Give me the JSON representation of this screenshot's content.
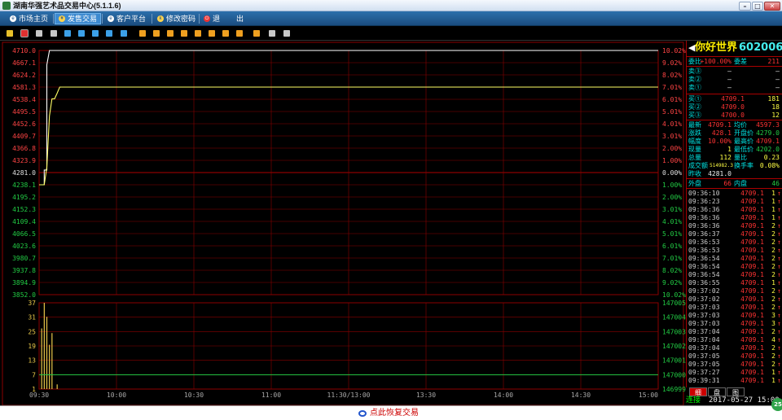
{
  "window": {
    "title": "湖南华强艺术品交易中心(5.1.1.6)"
  },
  "menu": {
    "items": [
      {
        "label": "市场主页",
        "icon": "globe-icon",
        "active": false
      },
      {
        "label": "发售交易",
        "icon": "hand-icon",
        "active": true
      },
      {
        "label": "客户平台",
        "icon": "globe-icon",
        "active": false
      },
      {
        "label": "修改密码",
        "icon": "key-icon",
        "active": false
      },
      {
        "label": "退",
        "icon": "power-icon",
        "active": false
      },
      {
        "label": "出",
        "icon": "",
        "active": false
      }
    ]
  },
  "toolbar": {
    "icons": [
      "bar-chart-icon",
      "line-chart-icon",
      "candlestick-icon",
      "table-icon",
      "list-icon",
      "q1-icon",
      "q2-icon",
      "q3-icon",
      "x-icon",
      "f1-icon",
      "f2-icon",
      "f3-icon",
      "f4-icon",
      "f5-icon",
      "f6-icon",
      "f7-icon",
      "f8-icon",
      "f9-icon",
      "draw-icon",
      "settings-icon"
    ]
  },
  "chart_data": [
    {
      "type": "line",
      "title": "",
      "y_ticks_left": [
        "4710.0",
        "4667.1",
        "4624.2",
        "4581.3",
        "4538.4",
        "4495.5",
        "4452.6",
        "4409.7",
        "4366.8",
        "4323.9",
        "4281.0",
        "4238.1",
        "4195.2",
        "4152.3",
        "4109.4",
        "4066.5",
        "4023.6",
        "3980.7",
        "3937.8",
        "3894.9",
        "3852.0"
      ],
      "y_ticks_right": [
        "10.02%",
        "9.02%",
        "8.02%",
        "7.01%",
        "6.01%",
        "5.01%",
        "4.01%",
        "3.01%",
        "2.00%",
        "1.00%",
        "0.00%",
        "1.00%",
        "2.00%",
        "3.01%",
        "4.01%",
        "5.01%",
        "6.01%",
        "7.01%",
        "8.02%",
        "9.02%",
        "10.02%"
      ],
      "x_ticks": [
        "09:30",
        "10:00",
        "10:30",
        "11:00",
        "11:30/13:00",
        "13:30",
        "14:00",
        "14:30",
        "15:00"
      ],
      "ylim": [
        3852.0,
        4710.0
      ],
      "prev_close": 4281.0,
      "series": [
        {
          "color": "#ffffff",
          "points": [
            [
              0,
              4238.1
            ],
            [
              2,
              4238.1
            ],
            [
              2,
              4290
            ],
            [
              3,
              4290
            ],
            [
              3,
              4660
            ],
            [
              4,
              4710.0
            ],
            [
              240,
              4710.0
            ]
          ]
        },
        {
          "color": "#ffff66",
          "points": [
            [
              0,
              4238.1
            ],
            [
              2,
              4238.1
            ],
            [
              3,
              4300
            ],
            [
              4,
              4480
            ],
            [
              5,
              4540
            ],
            [
              6,
              4540
            ],
            [
              7,
              4560
            ],
            [
              8,
              4581.3
            ],
            [
              9,
              4581.3
            ],
            [
              240,
              4581.3
            ]
          ]
        }
      ]
    },
    {
      "type": "bar",
      "y_ticks_left": [
        "37",
        "31",
        "25",
        "19",
        "13",
        "7",
        "1"
      ],
      "y_ticks_right": [
        "147005",
        "147004",
        "147003",
        "147002",
        "147001",
        "147000",
        "146999"
      ],
      "ylim": [
        0,
        37
      ],
      "bars": [
        [
          1,
          26
        ],
        [
          2,
          37
        ],
        [
          3,
          31
        ],
        [
          4,
          19
        ],
        [
          5,
          24
        ],
        [
          7,
          2
        ]
      ],
      "line_value": 147000,
      "line_range": [
        146999,
        147005
      ]
    }
  ],
  "quote": {
    "name": "你好世界",
    "code": "602006",
    "weibi_label": "委比",
    "weibi_value": "+100.00%",
    "weicha_label": "委差",
    "weicha_value": "211",
    "asks": [
      {
        "label": "卖③",
        "price": "—",
        "vol": "—"
      },
      {
        "label": "卖②",
        "price": "—",
        "vol": "—"
      },
      {
        "label": "卖①",
        "price": "—",
        "vol": "—"
      }
    ],
    "bids": [
      {
        "label": "买①",
        "price": "4709.1",
        "vol": "181"
      },
      {
        "label": "买②",
        "price": "4709.0",
        "vol": "18"
      },
      {
        "label": "买③",
        "price": "4700.0",
        "vol": "12"
      }
    ],
    "stats": [
      {
        "l1": "最新",
        "v1": "4709.1",
        "l2": "均价",
        "v2": "4597.3"
      },
      {
        "l1": "涨跌",
        "v1": "428.1",
        "l2": "开盘价",
        "v2": "4279.0"
      },
      {
        "l1": "幅度",
        "v1": "10.00%",
        "l2": "最高价",
        "v2": "4709.1"
      },
      {
        "l1": "现量",
        "v1": "1",
        "l2": "最低价",
        "v2": "4202.0"
      },
      {
        "l1": "总量",
        "v1": "112",
        "l2": "量比",
        "v2": "0.23"
      },
      {
        "l1": "成交额",
        "v1": "514982.3",
        "l2": "换手率",
        "v2": "0.08%"
      },
      {
        "l1": "昨收",
        "v1": "4281.0",
        "l2": "",
        "v2": ""
      }
    ],
    "outer_label": "外盘",
    "outer_value": "66",
    "inner_label": "内盘",
    "inner_value": "46",
    "ticks": [
      {
        "t": "09:36:10",
        "p": "4709.1",
        "v": "1"
      },
      {
        "t": "09:36:23",
        "p": "4709.1",
        "v": "1"
      },
      {
        "t": "09:36:36",
        "p": "4709.1",
        "v": "1"
      },
      {
        "t": "09:36:36",
        "p": "4709.1",
        "v": "1"
      },
      {
        "t": "09:36:36",
        "p": "4709.1",
        "v": "2"
      },
      {
        "t": "09:36:37",
        "p": "4709.1",
        "v": "2"
      },
      {
        "t": "09:36:53",
        "p": "4709.1",
        "v": "2"
      },
      {
        "t": "09:36:53",
        "p": "4709.1",
        "v": "2"
      },
      {
        "t": "09:36:54",
        "p": "4709.1",
        "v": "2"
      },
      {
        "t": "09:36:54",
        "p": "4709.1",
        "v": "2"
      },
      {
        "t": "09:36:54",
        "p": "4709.1",
        "v": "2"
      },
      {
        "t": "09:36:55",
        "p": "4709.1",
        "v": "1"
      },
      {
        "t": "09:37:02",
        "p": "4709.1",
        "v": "2"
      },
      {
        "t": "09:37:02",
        "p": "4709.1",
        "v": "2"
      },
      {
        "t": "09:37:03",
        "p": "4709.1",
        "v": "2"
      },
      {
        "t": "09:37:03",
        "p": "4709.1",
        "v": "3"
      },
      {
        "t": "09:37:03",
        "p": "4709.1",
        "v": "3"
      },
      {
        "t": "09:37:04",
        "p": "4709.1",
        "v": "2"
      },
      {
        "t": "09:37:04",
        "p": "4709.1",
        "v": "4"
      },
      {
        "t": "09:37:04",
        "p": "4709.1",
        "v": "2"
      },
      {
        "t": "09:37:05",
        "p": "4709.1",
        "v": "2"
      },
      {
        "t": "09:37:05",
        "p": "4709.1",
        "v": "2"
      },
      {
        "t": "09:37:27",
        "p": "4709.1",
        "v": "1"
      },
      {
        "t": "09:39:31",
        "p": "4709.1",
        "v": "1"
      }
    ],
    "tabs": [
      "细",
      "盘",
      "图"
    ]
  },
  "status": {
    "connection": "连接",
    "datetime": "2017-05-27 15:00"
  },
  "bottom": {
    "resume_label": "点此恢复交易"
  },
  "badge": {
    "label": "25"
  },
  "colors": {
    "up": "#ff3333",
    "down": "#00cc00",
    "grid": "#8b0000",
    "price_line": "#ffffff",
    "avg_line": "#ffff66",
    "label": "#00e5e5"
  }
}
